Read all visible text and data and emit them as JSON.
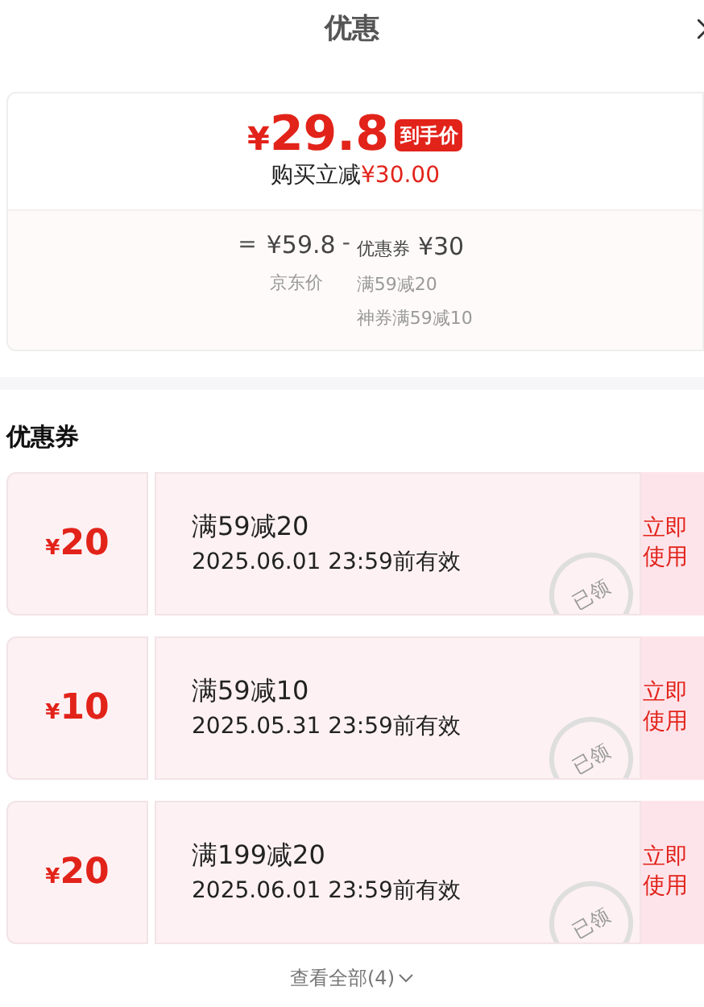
{
  "header": {
    "title": "优惠"
  },
  "summary": {
    "price_symbol": "¥",
    "price": "29.8",
    "price_tag": "到手价",
    "saving_label": "购买立减",
    "saving_amount": "¥30.00",
    "equals": "=",
    "base_price": "¥59.8",
    "base_label": "京东价",
    "minus": "-",
    "coupon_label": "优惠券",
    "coupon_total": "¥30",
    "coupon_details": [
      "满59减20",
      "神券满59减10"
    ]
  },
  "section_title": "优惠券",
  "coupons": [
    {
      "symbol": "¥",
      "amount": "20",
      "rule": "满59减20",
      "validity": "2025.06.01 23:59前有效",
      "stamp": "已领",
      "claimed": true,
      "action": "立即使用"
    },
    {
      "symbol": "¥",
      "amount": "10",
      "rule": "满59减10",
      "validity": "2025.05.31 23:59前有效",
      "stamp": "已领",
      "claimed": true,
      "action": "立即使用"
    },
    {
      "symbol": "¥",
      "amount": "20",
      "rule": "满199减20",
      "validity": "2025.06.01 23:59前有效",
      "stamp": "已领",
      "claimed": true,
      "action": "立即使用"
    }
  ],
  "view_all": "查看全部(4)"
}
